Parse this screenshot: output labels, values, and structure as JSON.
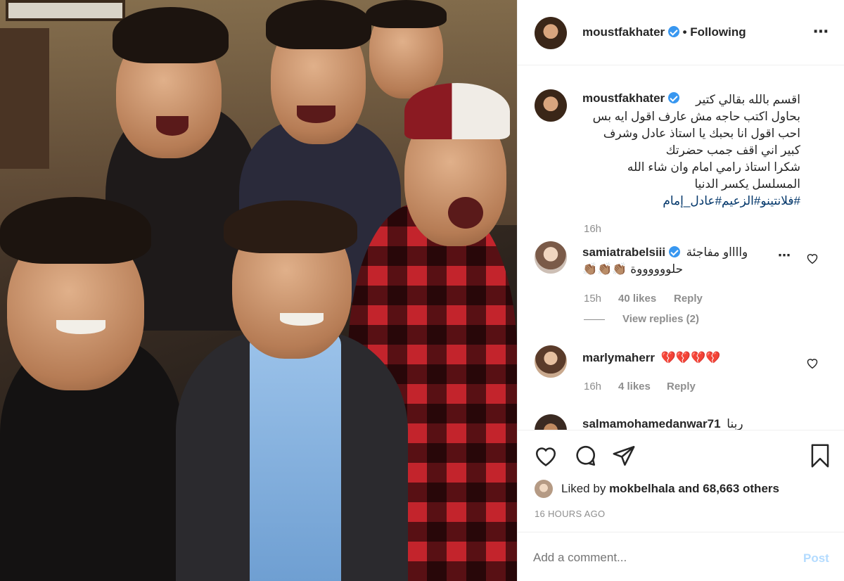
{
  "post": {
    "author": "moustfakhater",
    "follow_status": "• Following",
    "more_icon": "more-horizontal-icon",
    "caption": {
      "lines": [
        "اقسم بالله بقالي كتير",
        "بحاول اكتب حاجه مش عارف اقول ايه بس",
        "احب اقول انا بحبك يا استاذ عادل وشرف",
        "كبير اني اقف جمب حضرتك",
        "شكرا استاذ رامي امام وان شاء الله",
        "المسلسل يكسر الدنيا"
      ],
      "hashtags": "#فلانتينو#الزعيم#عادل_إمام",
      "time": "16h"
    },
    "comments": [
      {
        "user": "samiatrabelsiii",
        "verified": true,
        "text": "وااااو مفاجئة",
        "text2": "حلووووووة 👏🏽👏🏽👏🏽",
        "time": "15h",
        "likes": "40 likes",
        "reply": "Reply",
        "view_replies": "View replies (2)"
      },
      {
        "user": "marlymaherr",
        "verified": false,
        "text": "💔💔💔💔",
        "time": "16h",
        "likes": "4 likes",
        "reply": "Reply"
      },
      {
        "user": "salmamohamedanwar71",
        "verified": false,
        "text": "ربنا"
      }
    ],
    "liked_by_prefix": "Liked by",
    "liked_by_user": "mokbelhala",
    "liked_by_suffix": "and 68,663 others",
    "timestamp": "16 HOURS AGO",
    "comment_placeholder": "Add a comment...",
    "post_button": "Post",
    "colors": {
      "verified": "#3897f0",
      "post_button_disabled": "#b3dbff",
      "hashtag": "#003569",
      "border": "#efefef",
      "secondary_text": "#8e8e8e"
    }
  }
}
